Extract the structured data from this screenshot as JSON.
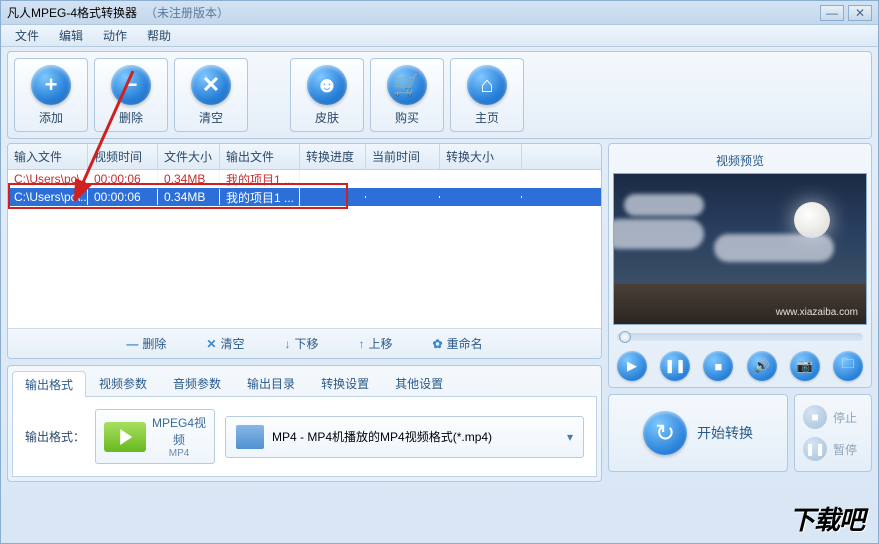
{
  "titlebar": {
    "title": "凡人MPEG-4格式转换器",
    "version": "（未注册版本）",
    "minimize": "—",
    "close": "✕"
  },
  "menu": {
    "file": "文件",
    "edit": "编辑",
    "action": "动作",
    "help": "帮助"
  },
  "toolbar": {
    "add": "添加",
    "delete": "删除",
    "clear": "清空",
    "skin": "皮肤",
    "buy": "购买",
    "home": "主页"
  },
  "columns": {
    "input": "输入文件",
    "vtime": "视频时间",
    "fsize": "文件大小",
    "output": "输出文件",
    "progress": "转换进度",
    "curtime": "当前时间",
    "convsize": "转换大小"
  },
  "rows": [
    {
      "input": "C:\\Users\\pc\\...",
      "vtime": "00:00:06",
      "fsize": "0.34MB",
      "output": "我的项目1 ...",
      "progress": "",
      "curtime": "",
      "convsize": ""
    },
    {
      "input": "C:\\Users\\pc\\...",
      "vtime": "00:00:06",
      "fsize": "0.34MB",
      "output": "我的项目1 ...",
      "progress": "",
      "curtime": "",
      "convsize": ""
    }
  ],
  "listActions": {
    "delete": "删除",
    "clear": "清空",
    "down": "下移",
    "up": "上移",
    "rename": "重命名"
  },
  "tabs": {
    "format": "输出格式",
    "videoParam": "视频参数",
    "audioParam": "音频参数",
    "outputDir": "输出目录",
    "convSetting": "转换设置",
    "otherSetting": "其他设置"
  },
  "output": {
    "label": "输出格式：",
    "codecTop": "MPEG4视",
    "codecBottom": "频",
    "codecSub": "MP4",
    "formatDesc": "MP4 - MP4机播放的MP4视频格式(*.mp4)"
  },
  "preview": {
    "title": "视频预览",
    "watermark": "www.xiazaiba.com"
  },
  "convert": {
    "start": "开始转换",
    "stop": "停止",
    "pause": "暂停"
  },
  "logo": "下载吧"
}
